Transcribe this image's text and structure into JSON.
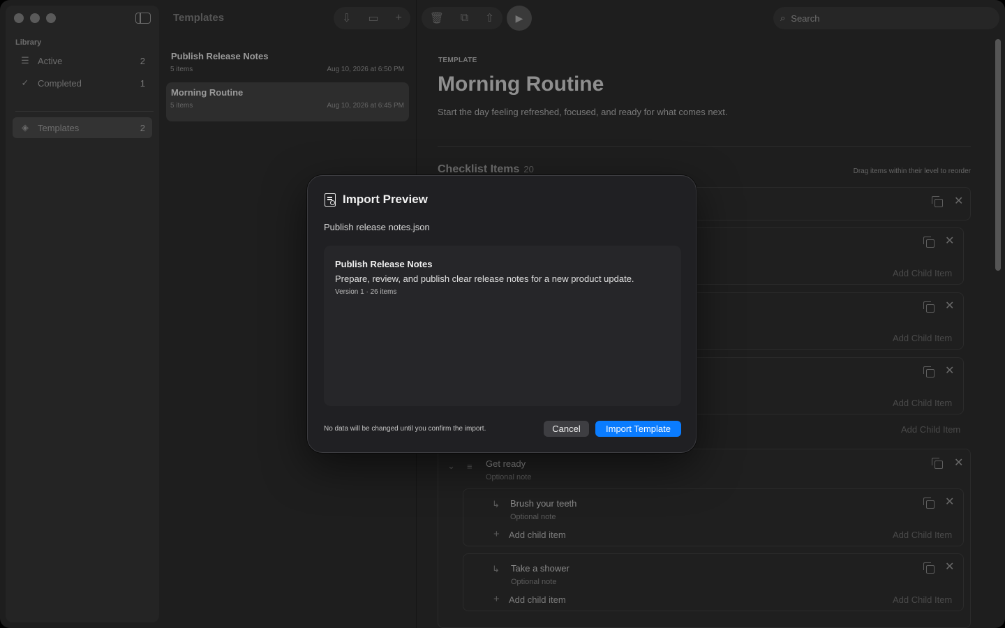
{
  "sidebar": {
    "section_label": "Library",
    "items": [
      {
        "label": "Active",
        "count": "2",
        "icon": "list-icon"
      },
      {
        "label": "Completed",
        "count": "1",
        "icon": "check-circle-icon"
      },
      {
        "label": "Templates",
        "count": "2",
        "icon": "layers-icon"
      }
    ]
  },
  "list": {
    "title": "Templates",
    "items": [
      {
        "name": "Publish Release Notes",
        "count": "5 items",
        "date": "Aug 10, 2026 at 6:50 PM"
      },
      {
        "name": "Morning Routine",
        "count": "5 items",
        "date": "Aug 10, 2026 at 6:45 PM"
      }
    ]
  },
  "search": {
    "placeholder": "Search"
  },
  "detail": {
    "kicker": "TEMPLATE",
    "title": "Morning Routine",
    "description": "Start the day feeling refreshed, focused, and ready for what comes next.",
    "section": "Checklist Items",
    "section_count": "20",
    "hint": "Drag items within their level to reorder",
    "add_child_item_right": "Add Child Item",
    "add_child_item_left": "Add child item",
    "optional_note": "Optional note",
    "items": [
      {
        "title": "Get ready"
      },
      {
        "title": "Brush your teeth"
      },
      {
        "title": "Take a shower"
      }
    ]
  },
  "modal": {
    "title": "Import Preview",
    "file": "Publish release notes.json",
    "preview": {
      "name": "Publish Release Notes",
      "description": "Prepare, review, and publish clear release notes for a new product update.",
      "meta": "Version 1 · 26 items"
    },
    "note": "No data will be changed until you confirm the import.",
    "cancel": "Cancel",
    "confirm": "Import Template"
  },
  "colors": {
    "accent": "#0a7cff",
    "window_bg": "#1e1e1e",
    "modal_bg": "#202023"
  }
}
